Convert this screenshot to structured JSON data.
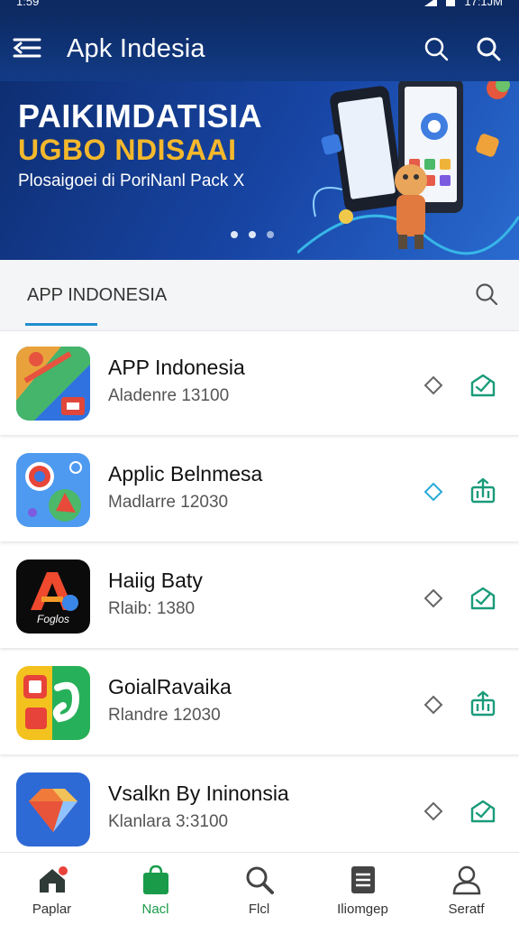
{
  "status_bar": {
    "time": "1:59",
    "clock": "17:1JM"
  },
  "app_bar": {
    "title": "Apk Indesia"
  },
  "banner": {
    "headline": "PAIKIMDATISIA",
    "subheadline": "UGBO NDISAAI",
    "tagline": "Plosaigoei di PoriNanl Pack X",
    "pager": {
      "pages": 3,
      "active": 1
    }
  },
  "section": {
    "tab_label": "APP INDONESIA"
  },
  "apps": [
    {
      "name": "APP Indonesia",
      "meta": "Aladenre 13100",
      "action": "install-icon"
    },
    {
      "name": "Applic Belnmesa",
      "meta": "Madlarre 12030",
      "action": "download-icon"
    },
    {
      "name": "Haiig Baty",
      "meta": "Rlaib: 1380",
      "action": "install-icon"
    },
    {
      "name": "GoialRavaika",
      "meta": "Rlandre 12030",
      "action": "download-icon"
    },
    {
      "name": "Vsalkn By Ininonsia",
      "meta": "Klanlara 3:3100",
      "action": "install-icon"
    }
  ],
  "icon_logo_text": "Foglos",
  "bottom_nav": [
    {
      "label": "Paplar",
      "icon": "home-icon"
    },
    {
      "label": "Nacl",
      "icon": "bag-icon",
      "active": true
    },
    {
      "label": "Flcl",
      "icon": "search-icon"
    },
    {
      "label": "Iliomgep",
      "icon": "list-icon"
    },
    {
      "label": "Seratf",
      "icon": "profile-icon"
    }
  ],
  "colors": {
    "appbar": "#0d2a63",
    "accent": "#1f8fcf",
    "active_nav": "#1a9b4a",
    "banner_gold": "#f4b82c"
  }
}
